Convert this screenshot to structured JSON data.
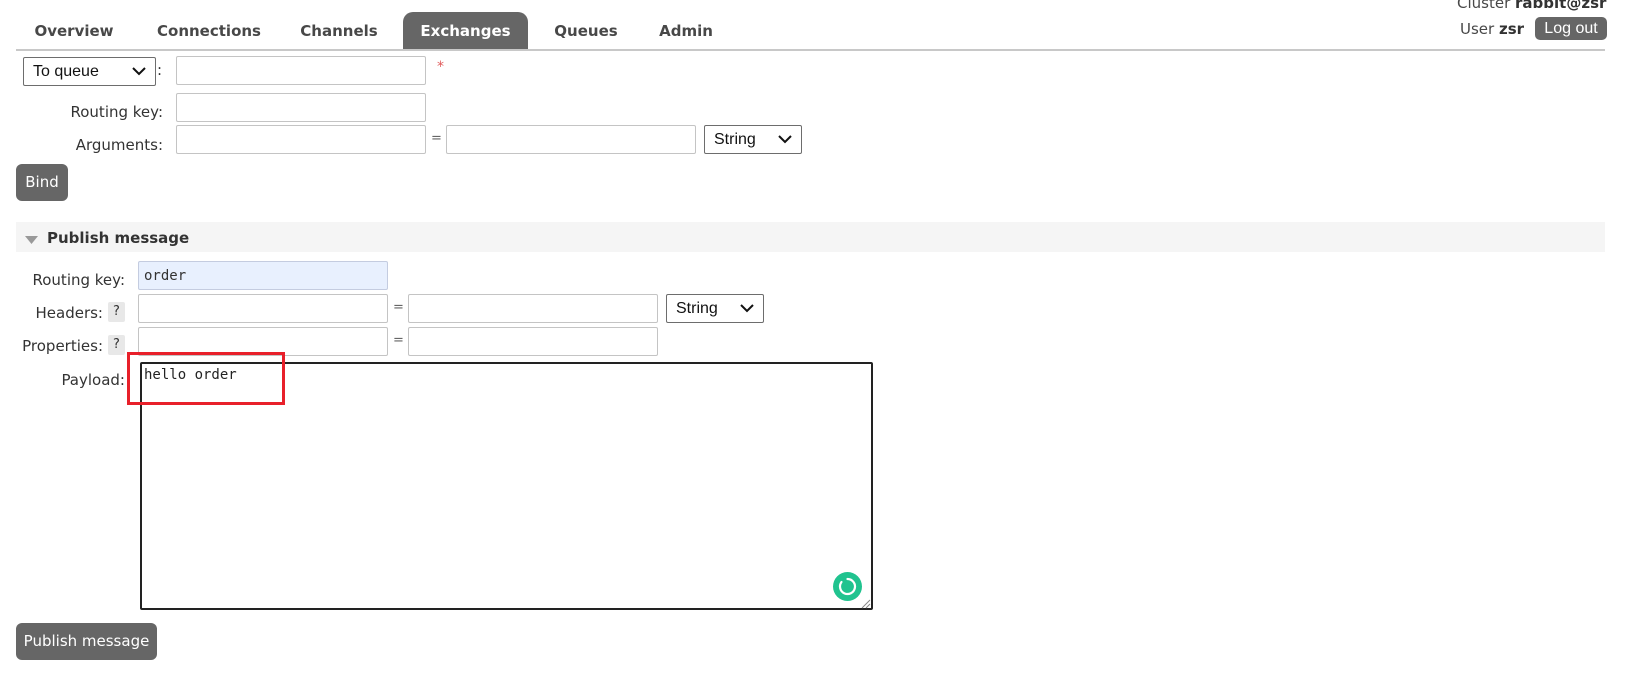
{
  "nav": {
    "tabs": [
      {
        "label": "Overview"
      },
      {
        "label": "Connections"
      },
      {
        "label": "Channels"
      },
      {
        "label": "Exchanges",
        "active": true
      },
      {
        "label": "Queues"
      },
      {
        "label": "Admin"
      }
    ]
  },
  "header": {
    "cluster_label": "Cluster",
    "cluster_name": "rabbit@zsr",
    "user_label": "User",
    "user_name": "zsr",
    "logout_label": "Log out"
  },
  "bind_form": {
    "destination_type": "To queue",
    "colon": ":",
    "destination_value": "",
    "required_mark": "*",
    "routing_key_label": "Routing key:",
    "routing_key_value": "",
    "arguments_label": "Arguments:",
    "arg_key": "",
    "eq": "=",
    "arg_value": "",
    "arg_type": "String",
    "bind_label": "Bind"
  },
  "publish": {
    "section_title": "Publish message",
    "routing_key_label": "Routing key:",
    "routing_key_value": "order",
    "headers_label": "Headers:",
    "help": "?",
    "header_key": "",
    "eq": "=",
    "header_value": "",
    "header_type": "String",
    "properties_label": "Properties:",
    "property_key": "",
    "property_value": "",
    "payload_label": "Payload:",
    "payload_value": "hello order",
    "publish_label": "Publish message"
  },
  "colors": {
    "tab_active_bg": "#666666",
    "button_bg": "#666666",
    "highlight": "#e8202a",
    "widget_green": "#20c38f",
    "autofill_bg": "#e8f0fe"
  }
}
